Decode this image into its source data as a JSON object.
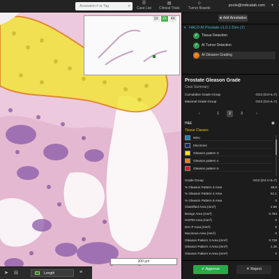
{
  "topbar": {
    "search_placeholder": "Accession # or Tag",
    "nav": [
      {
        "label": "Case List",
        "icon": "list-icon"
      },
      {
        "label": "Clinical Trials",
        "icon": "clipboard-icon"
      },
      {
        "label": "Tumor Boards",
        "icon": "people-icon"
      }
    ],
    "user": "pcole@indicalab.com"
  },
  "viewer": {
    "thumb_toolbar": [
      "1X",
      "2X",
      "4X"
    ],
    "scalebar": "300 μm",
    "tool_label": "Length"
  },
  "panel": {
    "add_annotation": "Add Annotation",
    "halo_title": "HALO AI Prostate v1.0.1-Dev (1)",
    "steps": [
      {
        "label": "Tissue Detection",
        "icon": "check-icon"
      },
      {
        "label": "AI Tumor Detection",
        "icon": "check-icon"
      },
      {
        "label": "AI Gleason Grading",
        "icon": "minus-icon"
      }
    ],
    "section_title": "Prostate Gleason Grade",
    "section_sub": "Case Summary",
    "case_summary": [
      {
        "label": "Cumulative Grade Group",
        "value": "GG3 (G3+4=7)"
      },
      {
        "label": "Maximal Grade Group",
        "value": "GG3 (G3+4=7)"
      }
    ],
    "pager": {
      "prev": "‹",
      "pages": [
        "1",
        "2",
        "3"
      ],
      "current": "2",
      "next": "›"
    },
    "he_label": "H&E",
    "tissue_classes_label": "Tissue Classes",
    "classes": [
      {
        "label": "Nitro",
        "color": "#1a7fb5"
      },
      {
        "label": "Mucinous",
        "color": "#1c2a6b"
      },
      {
        "label": "Gleason pattern 3",
        "color": "#f5e400"
      },
      {
        "label": "Gleason pattern 4",
        "color": "#f07a1a"
      },
      {
        "label": "Gleason pattern 5",
        "color": "#d11f1f"
      }
    ],
    "metrics": [
      {
        "label": "Grade Group",
        "value": "GG3 (G3 4+3=7)"
      },
      {
        "label": "% Gleason Pattern 3 Area",
        "value": "38.9"
      },
      {
        "label": "% Gleason Pattern 4 Area",
        "value": "61.1"
      },
      {
        "label": "% Gleason Pattern 5 Area",
        "value": "0"
      },
      {
        "label": "Classified Area (mm²)",
        "value": "2.66"
      },
      {
        "label": "Benign Area (mm²)",
        "value": "0.783"
      },
      {
        "label": "HGPIN Area (mm²)",
        "value": "0"
      },
      {
        "label": "IDC-P Area (mm²)",
        "value": "0"
      },
      {
        "label": "Mucinous Area (mm²)",
        "value": "0"
      },
      {
        "label": "Gleason Pattern 3 Area (mm²)",
        "value": "0.739"
      },
      {
        "label": "Gleason Pattern 4 Area (mm²)",
        "value": "1.16"
      },
      {
        "label": "Gleason Pattern 5 Area (mm²)",
        "value": "0"
      }
    ],
    "approve": "Approve",
    "reject": "Reject"
  },
  "colors": {
    "accent": "#3fb7c4",
    "approve": "#2aa84a",
    "tumor_fill": "#f2e63a",
    "tumor_outline": "#e07b1a"
  }
}
